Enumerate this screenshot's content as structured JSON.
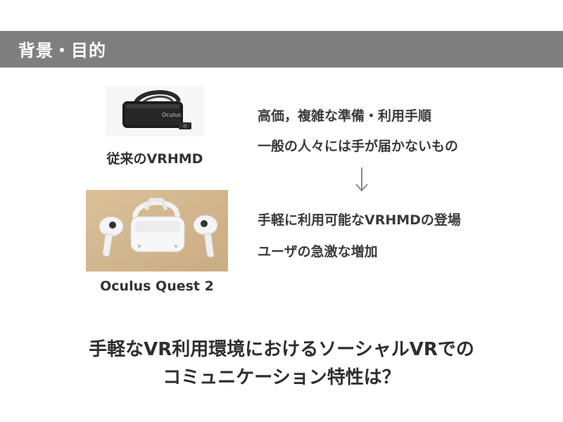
{
  "header": {
    "title": "背景・目的"
  },
  "left": {
    "old_hmd": {
      "caption": "従来のVRHMD",
      "logo_text": "Oculus",
      "icon": "vr-headset-dk2-icon"
    },
    "new_hmd": {
      "caption": "Oculus Quest 2",
      "icon": "vr-headset-quest2-icon"
    }
  },
  "right": {
    "problems": [
      "高価，複雑な準備・利用手順",
      "一般の人々には手が届かないもの"
    ],
    "arrow_icon": "down-arrow-icon",
    "changes": [
      "手軽に利用可能なVRHMDの登場",
      "ユーザの急激な増加"
    ]
  },
  "conclusion": {
    "line1": "手軽なVR利用環境におけるソーシャルVRでの",
    "line2": "コミュニケーション特性は？"
  },
  "colors": {
    "header_bg": "#7f7f7f",
    "header_text": "#ffffff",
    "body_text": "#333333",
    "arrow": "#8a8a8a"
  }
}
